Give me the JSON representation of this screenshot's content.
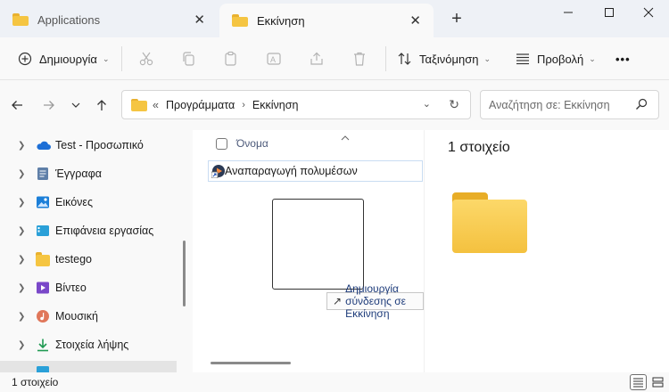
{
  "tabs": [
    {
      "label": "Applications"
    },
    {
      "label": "Εκκίνηση"
    }
  ],
  "toolbar": {
    "new_label": "Δημιουργία",
    "sort_label": "Ταξινόμηση",
    "view_label": "Προβολή",
    "more_label": "•••"
  },
  "address": {
    "prefix": "«",
    "segments": [
      "Προγράμματα",
      "Εκκίνηση"
    ]
  },
  "search": {
    "placeholder": "Αναζήτηση σε: Εκκίνηση"
  },
  "sidebar": {
    "items": [
      {
        "label": "Test - Προσωπικό",
        "icon": "cloud-icon"
      },
      {
        "label": "Έγγραφα",
        "icon": "documents-icon"
      },
      {
        "label": "Εικόνες",
        "icon": "pictures-icon"
      },
      {
        "label": "Επιφάνεια εργασίας",
        "icon": "desktop-icon"
      },
      {
        "label": "testego",
        "icon": "folder-icon"
      },
      {
        "label": "Βίντεο",
        "icon": "videos-icon"
      },
      {
        "label": "Μουσική",
        "icon": "music-icon"
      },
      {
        "label": "Στοιχεία λήψης",
        "icon": "downloads-icon"
      }
    ]
  },
  "filelist": {
    "column_name": "Όνομα",
    "rows": [
      {
        "name": "Αναπαραγωγή πολυμέσων"
      }
    ],
    "drag_tooltip": "Δημιουργία σύνδεσης σε Εκκίνηση"
  },
  "preview": {
    "count_text": "1 στοιχείο"
  },
  "status": {
    "count_text": "1 στοιχείο"
  },
  "colors": {
    "accent": "#0067c0",
    "folder": "#f5c542"
  }
}
